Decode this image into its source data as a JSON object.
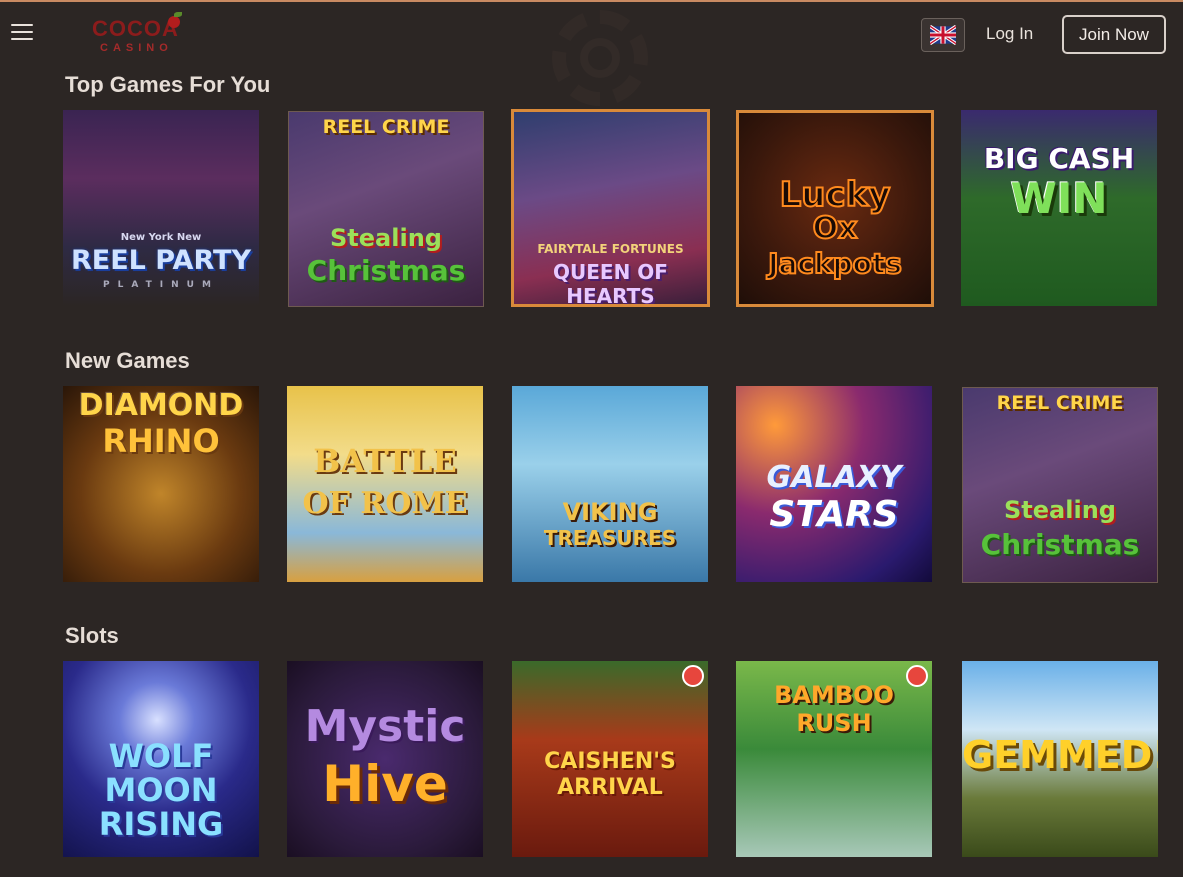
{
  "header": {
    "logo_main": "COCOA",
    "logo_sub": "CASINO",
    "login_label": "Log In",
    "join_label": "Join Now",
    "flag_icon": "uk-flag-icon",
    "menu_icon": "hamburger-icon"
  },
  "sections": [
    {
      "title": "Top Games For You",
      "games": [
        {
          "name": "New York New REEL PARTY PLATINUM",
          "line1": "New York New",
          "line2": "REEL PARTY",
          "line3": "PLATINUM"
        },
        {
          "name": "REEL CRIME Stealing Christmas",
          "line1": "REEL CRIME",
          "line2": "Stealing",
          "line3": "Christmas"
        },
        {
          "name": "FAIRYTALE FORTUNES QUEEN OF HEARTS",
          "line1": "FAIRYTALE FORTUNES",
          "line2": "QUEEN OF HEARTS",
          "line3": ""
        },
        {
          "name": "Lucky Ox Jackpots",
          "line1": "Lucky",
          "line2": "Ox",
          "line3": "Jackpots"
        },
        {
          "name": "BIG CASH WIN",
          "line1": "BIG CASH",
          "line2": "WIN",
          "line3": ""
        }
      ]
    },
    {
      "title": "New Games",
      "games": [
        {
          "name": "DIAMOND RHINO",
          "line1": "DIAMOND",
          "line2": "RHINO",
          "line3": ""
        },
        {
          "name": "BATTLE OF ROME",
          "line1": "BATTLE",
          "line2": "OF ROME",
          "line3": ""
        },
        {
          "name": "VIKING TREASURES",
          "line1": "VIKING",
          "line2": "TREASURES",
          "line3": ""
        },
        {
          "name": "GALAXY STARS",
          "line1": "GALAXY",
          "line2": "STARS",
          "line3": ""
        },
        {
          "name": "REEL CRIME Stealing Christmas",
          "line1": "REEL CRIME",
          "line2": "Stealing",
          "line3": "Christmas"
        }
      ]
    },
    {
      "title": "Slots",
      "games": [
        {
          "name": "WOLF MOON RISING",
          "line1": "WOLF",
          "line2": "MOON",
          "line3": "RISING"
        },
        {
          "name": "Mystic Hive",
          "line1": "Mystic",
          "line2": "Hive",
          "line3": ""
        },
        {
          "name": "CAISHEN'S ARRIVAL",
          "line1": "CAISHEN'S",
          "line2": "ARRIVAL",
          "line3": ""
        },
        {
          "name": "BAMBOO RUSH",
          "line1": "BAMBOO",
          "line2": "RUSH",
          "line3": ""
        },
        {
          "name": "GEMMED!",
          "line1": "GEMMED!",
          "line2": "",
          "line3": ""
        }
      ]
    }
  ],
  "colors": {
    "background": "#2c2624",
    "accent_top_line": "#c98a62",
    "text": "#e9e2dc",
    "tile_highlight_border": "#d98a3a"
  }
}
